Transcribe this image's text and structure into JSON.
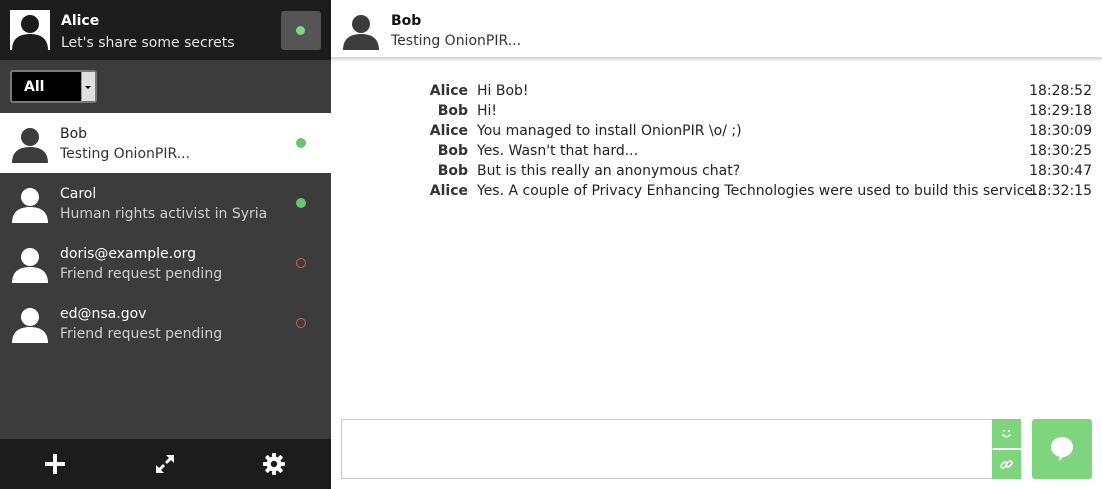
{
  "me": {
    "name": "Alice",
    "status": "Let's share some secrets",
    "status_color": "#7ed77e"
  },
  "filter": {
    "selected": "All"
  },
  "contacts": [
    {
      "name": "Bob",
      "status": "Testing OnionPIR...",
      "presence": "online",
      "active": true
    },
    {
      "name": "Carol",
      "status": "Human rights activist in Syria",
      "presence": "online",
      "active": false
    },
    {
      "name": "doris@example.org",
      "status": "Friend request pending",
      "presence": "pending",
      "active": false
    },
    {
      "name": "ed@nsa.gov",
      "status": "Friend request pending",
      "presence": "pending",
      "active": false
    }
  ],
  "footer": {
    "icons": [
      "add-contact-icon",
      "sync-icon",
      "settings-icon"
    ]
  },
  "chat": {
    "name": "Bob",
    "status": "Testing OnionPIR...",
    "messages": [
      {
        "author": "Alice",
        "text": "Hi Bob!",
        "time": "18:28:52"
      },
      {
        "author": "Bob",
        "text": "Hi!",
        "time": "18:29:18"
      },
      {
        "author": "Alice",
        "text": "You managed to install OnionPIR \\o/ ;)",
        "time": "18:30:09"
      },
      {
        "author": "Bob",
        "text": "Yes. Wasn't that hard...",
        "time": "18:30:25"
      },
      {
        "author": "Bob",
        "text": "But is this really an anonymous chat?",
        "time": "18:30:47"
      },
      {
        "author": "Alice",
        "text": "Yes. A couple of Privacy Enhancing Technologies were used to build this service...",
        "time": "18:32:15"
      }
    ]
  },
  "compose": {
    "value": "",
    "buttons": [
      "emoji-icon",
      "attach-icon",
      "send-icon"
    ]
  },
  "colors": {
    "accent": "#7ed57e",
    "online": "#6cc46c",
    "pending": "#d85a5a",
    "sidebar_bg": "#3c3c3c",
    "sidebar_header_bg": "#1c1c1c"
  }
}
